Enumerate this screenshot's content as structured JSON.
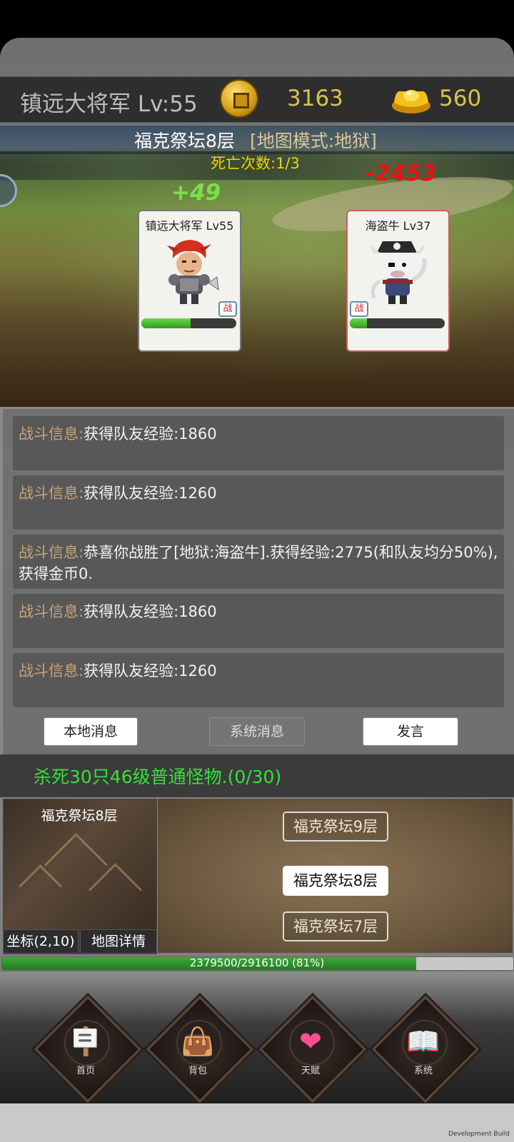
{
  "header": {
    "player_title": "镇远大将军 Lv:55",
    "gold": "3163",
    "ingot": "560"
  },
  "battle": {
    "map_name": "福克祭坛8层",
    "map_mode": "[地图模式:地狱]",
    "death_count": "死亡次数:1/3",
    "heal_number": "+49",
    "damage_number": "-2453",
    "player": {
      "name": "镇远大将军 Lv55",
      "tag": "战",
      "hp_fraction": 0.52
    },
    "enemy": {
      "name": "海盗牛 Lv37",
      "tag": "战",
      "hp_fraction": 0.18
    }
  },
  "messages": {
    "prefix": "战斗信息:",
    "items": [
      "获得队友经验:1860",
      "获得队友经验:1260",
      "恭喜你战胜了[地狱:海盗牛].获得经验:2775(和队友均分50%),获得金币0.",
      "获得队友经验:1860",
      "获得队友经验:1260"
    ],
    "local_button": "本地消息",
    "system_button": "系统消息",
    "speak_button": "发言"
  },
  "quest": {
    "text": "杀死30只46级普通怪物.(0/30)"
  },
  "map": {
    "current_name": "福克祭坛8层",
    "coord_button": "坐标(2,10)",
    "detail_button": "地图详情",
    "floor_up": "福克祭坛9层",
    "floor_current": "福克祭坛8层",
    "floor_down": "福克祭坛7层"
  },
  "exp": {
    "text": "2379500/2916100 (81%)",
    "fraction": 0.81
  },
  "nav": {
    "home": "首页",
    "bag": "背包",
    "talent": "天赋",
    "system": "系统"
  },
  "footer": {
    "dev_build": "Development Build"
  }
}
